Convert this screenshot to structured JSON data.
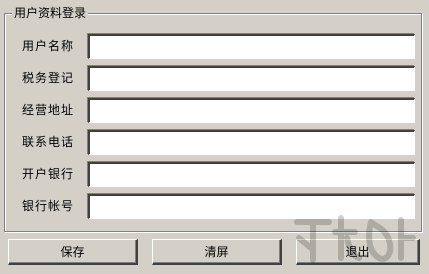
{
  "group": {
    "title": "用户资料登录"
  },
  "fields": [
    {
      "label": "用户名称",
      "value": ""
    },
    {
      "label": "税务登记",
      "value": ""
    },
    {
      "label": "经营地址",
      "value": ""
    },
    {
      "label": "联系电话",
      "value": ""
    },
    {
      "label": "开户银行",
      "value": ""
    },
    {
      "label": "银行帐号",
      "value": ""
    }
  ],
  "buttons": {
    "save": "保存",
    "clear": "清屏",
    "exit": "退出"
  },
  "colors": {
    "window_bg": "#d4d0c8",
    "field_bg": "#ffffff"
  }
}
